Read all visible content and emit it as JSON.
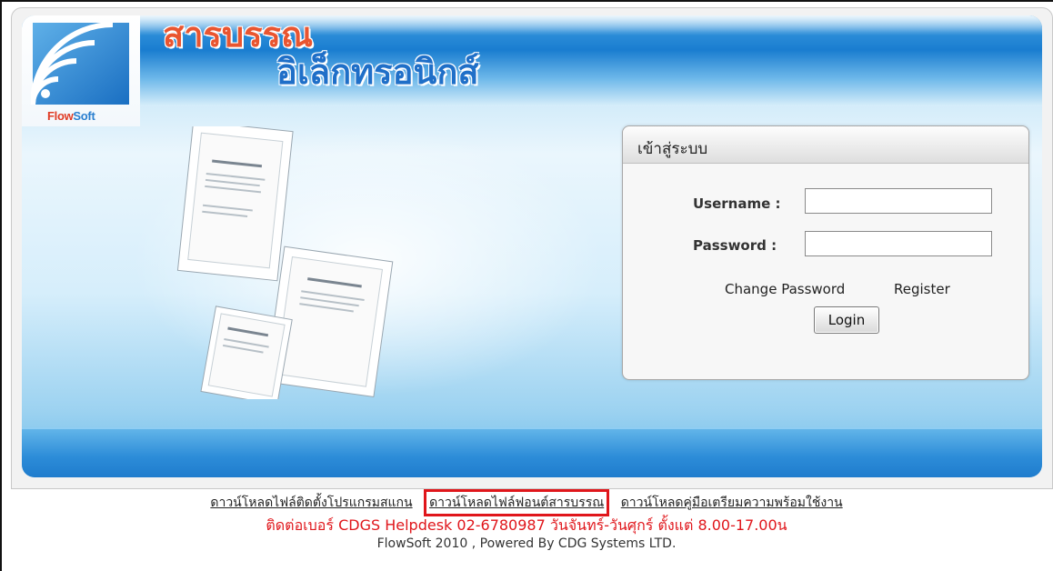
{
  "header": {
    "title_line1": "สารบรรณ",
    "title_line2": "อิเล็กทรอนิกส์",
    "brand": {
      "part1": "Flow",
      "part2": "Soft"
    }
  },
  "login": {
    "title": "เข้าสู่ระบบ",
    "username_label": "Username :",
    "username_value": "",
    "password_label": "Password :",
    "password_value": "",
    "change_password_label": "Change Password",
    "register_label": "Register",
    "login_button_label": "Login"
  },
  "footer": {
    "links": [
      {
        "label": "ดาวน์โหลดไฟล์ติดตั้งโปรแกรมสแกน"
      },
      {
        "label": "ดาวน์โหลดไฟล์ฟอนต์สารบรรณ"
      },
      {
        "label": "ดาวน์โหลดคู่มือเตรียมความพร้อมใช้งาน"
      }
    ],
    "helpdesk": "ติดต่อเบอร์ CDGS Helpdesk 02-6780987 วันจันทร์-วันศุกร์ ตั้งแต่ 8.00-17.00น",
    "powered_by": "FlowSoft 2010 , Powered By CDG Systems LTD."
  },
  "colors": {
    "header_blue": "#1a7dd0",
    "title_orange": "#e95530",
    "title_blue": "#1f6fc8",
    "highlight_red": "#e0161b"
  },
  "icons": [
    "flowsoft-logo-icon",
    "certificate-documents-illustration"
  ]
}
